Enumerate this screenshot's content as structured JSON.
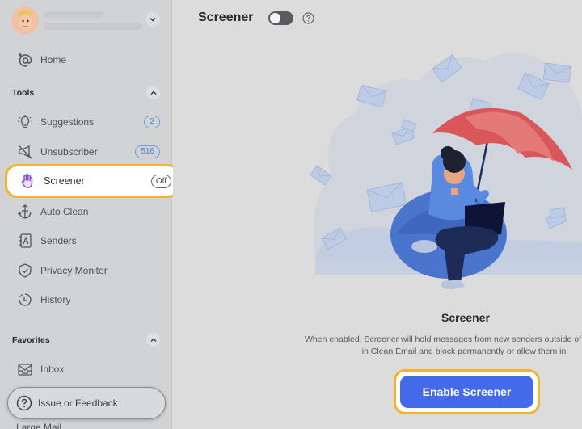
{
  "sidebar": {
    "account": {
      "avatar": "memoji-avatar"
    },
    "home": {
      "label": "Home",
      "icon": "at-sign-icon"
    },
    "tools_section": {
      "label": "Tools"
    },
    "tools": [
      {
        "label": "Suggestions",
        "icon": "lightbulb-icon",
        "badge": "2"
      },
      {
        "label": "Unsubscriber",
        "icon": "muted-megaphone-icon",
        "badge": "516"
      },
      {
        "label": "Screener",
        "icon": "hand-icon",
        "status": "Off"
      },
      {
        "label": "Auto Clean",
        "icon": "anchor-icon"
      },
      {
        "label": "Senders",
        "icon": "contact-book-icon"
      },
      {
        "label": "Privacy Monitor",
        "icon": "shield-check-icon"
      },
      {
        "label": "History",
        "icon": "clock-history-icon"
      }
    ],
    "favorites_section": {
      "label": "Favorites"
    },
    "favorites": [
      {
        "label": "Inbox",
        "icon": "inbox-icon"
      },
      {
        "label": "Large Mail",
        "icon": "large-mail-icon"
      }
    ],
    "feedback": {
      "label": "Issue or Feedback",
      "icon": "question-circle-icon"
    }
  },
  "main": {
    "title": "Screener",
    "toggle_state": "off",
    "empty_state": {
      "title": "Screener",
      "description_line1": "When enabled, Screener will hold messages from new senders outside of",
      "description_line2": "in Clean Email and block permanently or allow them in",
      "button_label": "Enable Screener"
    }
  },
  "colors": {
    "accent_blue": "#4469e9",
    "highlight_orange": "#f2b233",
    "badge_blue": "#4a7fd6",
    "screener_purple": "#8a4fd8",
    "umbrella_red": "#d9575a"
  }
}
